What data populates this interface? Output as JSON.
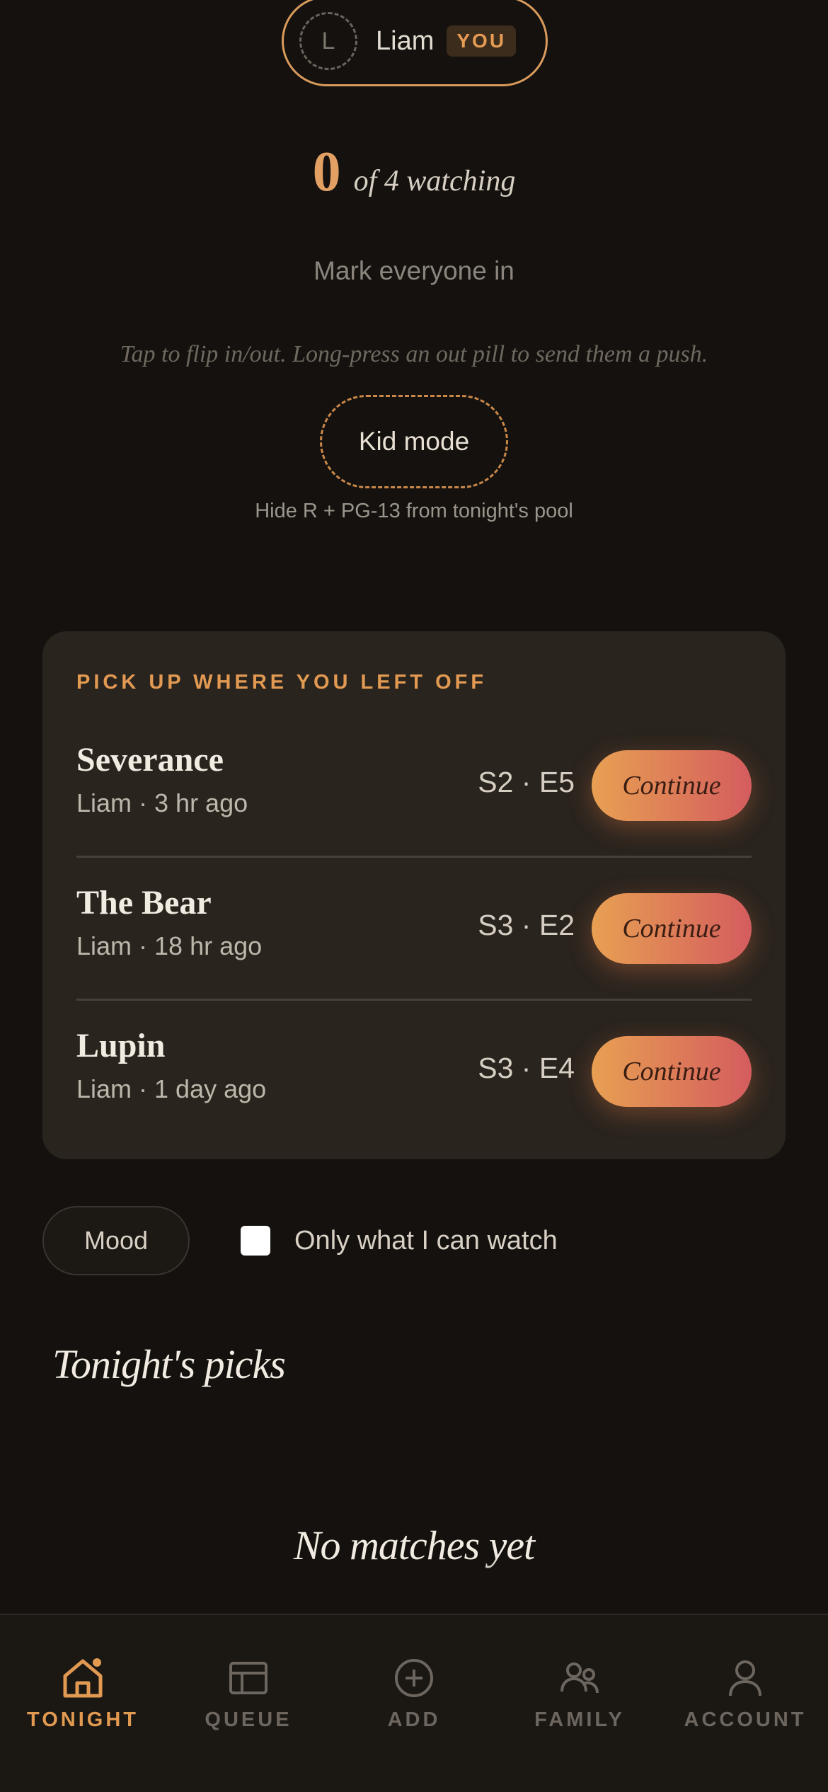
{
  "user": {
    "avatar_initial": "L",
    "name": "Liam",
    "badge": "YOU"
  },
  "watching": {
    "count": "0",
    "text": "of 4 watching"
  },
  "mark_all": "Mark everyone in",
  "hint": "Tap to flip in/out. Long-press an out pill to send them a push.",
  "kid_mode": {
    "label": "Kid mode",
    "sub": "Hide R + PG-13 from tonight's pool"
  },
  "continue_card": {
    "title": "PICK UP WHERE YOU LEFT OFF",
    "button_label": "Continue",
    "items": [
      {
        "title": "Severance",
        "meta": "Liam · 3 hr ago",
        "episode": "S2 · E5"
      },
      {
        "title": "The Bear",
        "meta": "Liam · 18 hr ago",
        "episode": "S3 · E2"
      },
      {
        "title": "Lupin",
        "meta": "Liam · 1 day ago",
        "episode": "S3 · E4"
      }
    ]
  },
  "filters": {
    "mood": "Mood",
    "only_watch": "Only what I can watch"
  },
  "picks_title": "Tonight's picks",
  "empty_title": "No matches yet",
  "tabs": [
    {
      "label": "TONIGHT",
      "icon": "home-icon"
    },
    {
      "label": "QUEUE",
      "icon": "queue-icon"
    },
    {
      "label": "ADD",
      "icon": "add-icon"
    },
    {
      "label": "FAMILY",
      "icon": "family-icon"
    },
    {
      "label": "ACCOUNT",
      "icon": "account-icon"
    }
  ],
  "colors": {
    "accent": "#e29a52",
    "background": "#14110e",
    "card": "#2a241e"
  }
}
